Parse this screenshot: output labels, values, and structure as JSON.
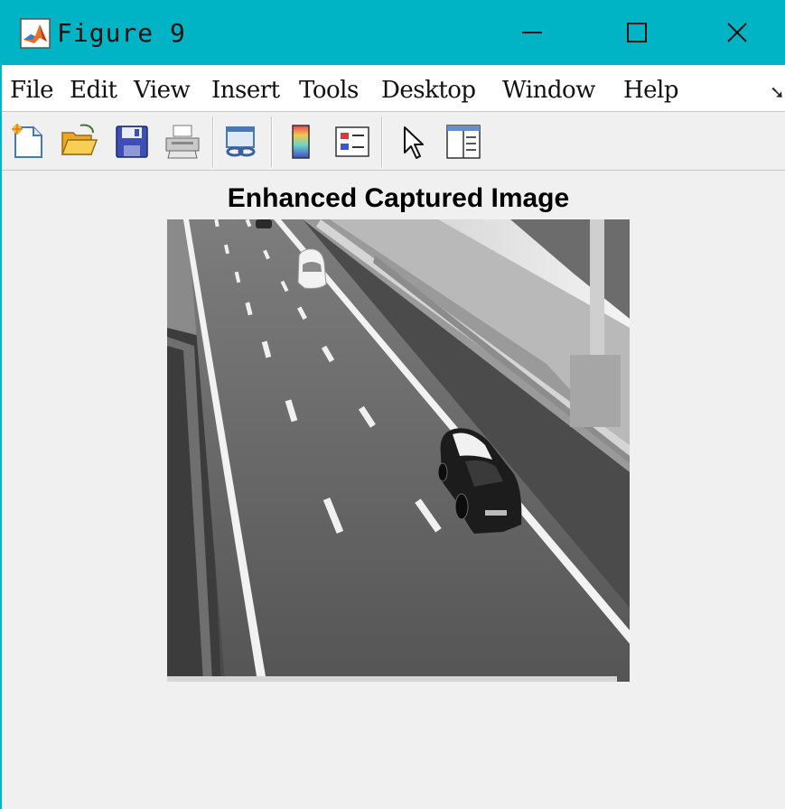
{
  "window": {
    "title": "Figure 9",
    "colors": {
      "titlebar": "#00b4c5",
      "background": "#f0f0f0"
    },
    "controls": [
      "minimize-icon",
      "maximize-icon",
      "close-icon"
    ]
  },
  "menu": {
    "items": [
      "File",
      "Edit",
      "View",
      "Insert",
      "Tools",
      "Desktop",
      "Window",
      "Help"
    ],
    "overflow_icon": "toolbar-overflow-arrow-icon"
  },
  "toolbar": {
    "icons": [
      "new-figure-icon",
      "open-file-icon",
      "save-icon",
      "print-icon",
      "link-plot-icon",
      "colorbar-icon",
      "legend-icon",
      "edit-plot-arrow-icon",
      "property-inspector-icon"
    ]
  },
  "figure": {
    "title": "Enhanced Captured Image",
    "image_description": "grayscale highway image with two cars"
  }
}
